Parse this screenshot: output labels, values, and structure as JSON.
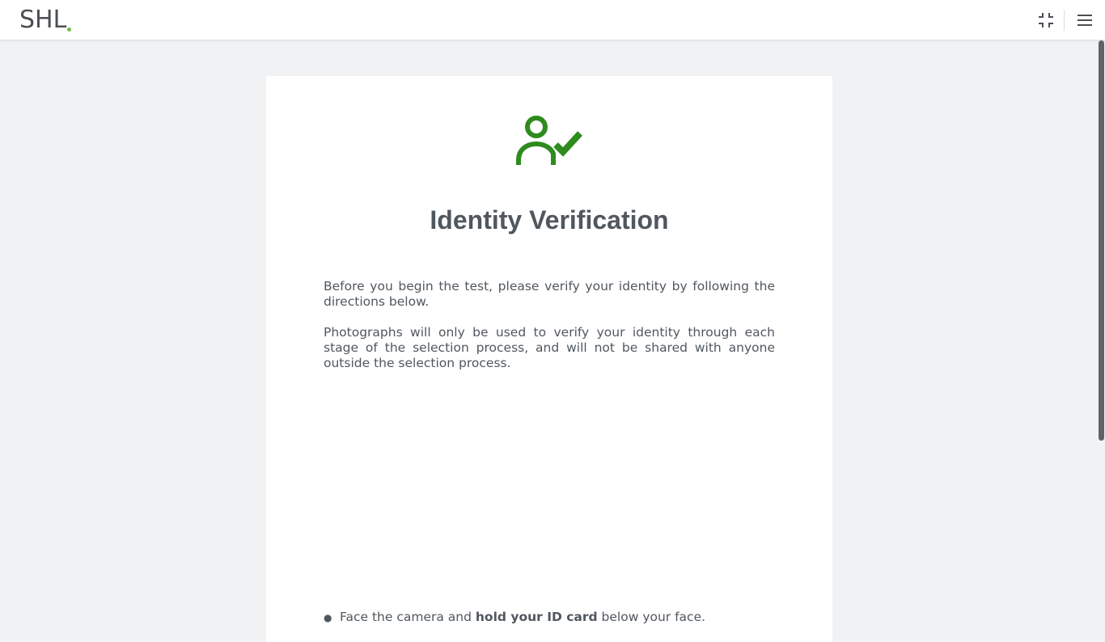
{
  "header": {
    "logo_text": "SHL",
    "logo_dot_color": "#6cc24a",
    "icons": [
      "exit-fullscreen-icon",
      "hamburger-menu-icon"
    ]
  },
  "card": {
    "icon": "user-check-icon",
    "icon_color": "#2e8b1e",
    "title": "Identity Verification",
    "paragraph_1": "Before you begin the test, please verify your identity by following the directions below.",
    "paragraph_2": "Photographs will only be used to verify your identity through each stage of the selection process, and will not be shared with anyone outside the selection process.",
    "instructions": [
      {
        "before": "Face the camera and ",
        "bold": "hold your ID card",
        "after": " below your face."
      }
    ]
  },
  "colors": {
    "page_background": "#f1f2f4",
    "text": "#50575e",
    "accent_green": "#2e8b1e"
  }
}
